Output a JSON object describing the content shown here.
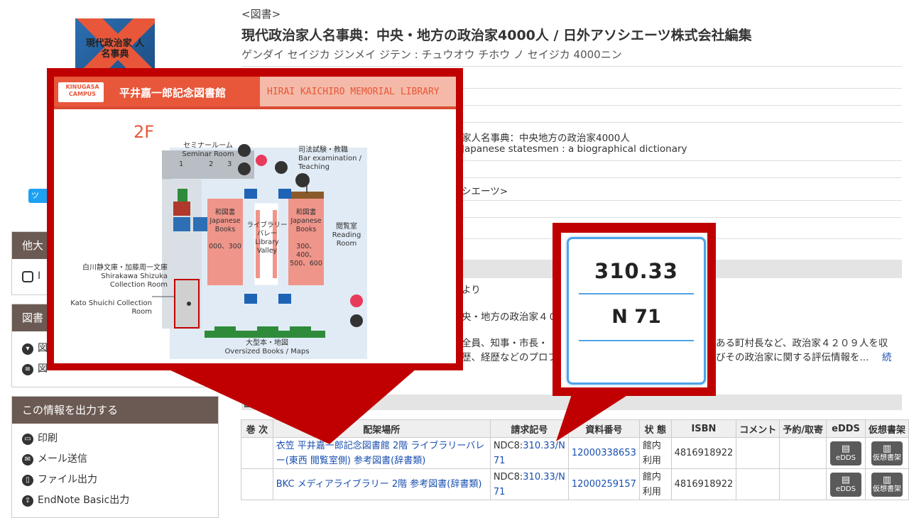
{
  "book": {
    "type": "<図書>",
    "title": "現代政治家人名事典：中央・地方の政治家4000人 / 日外アソシエーツ株式会社編集",
    "reading": "ゲンダイ セイジカ ジンメイ ジテン : チュウオウ チホウ ノ セイジカ 4000ニン",
    "cover_text": "現代政治家 人名事典"
  },
  "partial": {
    "line1": "家人名事典：中央地方の政治家4000人",
    "line2": "Japanese statesmen : a biographical dictionary",
    "line3": "シエーツ>",
    "note1": "より",
    "note2": "央・地方の政治家４０",
    "note3a": "全員、知事・市長・",
    "note3b": "ある町村長など、政治家４２０９人を収",
    "note4a": "歴、経歴などのプロフ",
    "note4b": "びその政治家に関する評伝情報を...",
    "more": "続"
  },
  "sidebar": {
    "twitter": "ツ",
    "panel1": {
      "title": "他大",
      "row1": "I"
    },
    "panel2": {
      "title": "図書",
      "row1": "図",
      "row2": "図"
    },
    "output": {
      "title": "この情報を出力する",
      "items": [
        "印刷",
        "メール送信",
        "ファイル出力",
        "EndNote Basic出力"
      ]
    }
  },
  "holdings": {
    "headers": [
      "巻 次",
      "配架場所",
      "請求記号",
      "資料番号",
      "状 態",
      "ISBN",
      "コメント",
      "予約/取寄",
      "eDDS",
      "仮想書架"
    ],
    "rows": [
      {
        "vol": "",
        "location": "衣笠 平井嘉一郎記念図書館 2階 ライブラリーバレー(東西 閲覧室側) 参考図書(辞書類)",
        "call_prefix": "NDC8:",
        "call_link": "310.33/N 71",
        "item_no": "12000338653",
        "status": "館内利用",
        "isbn": "4816918922",
        "comment": "",
        "reserve": "",
        "edds": "eDDS",
        "shelf": "仮想書架"
      },
      {
        "vol": "",
        "location": "BKC メディアライブラリー 2階 参考図書(辞書類)",
        "call_prefix": "NDC8:",
        "call_link": "310.33/N 71",
        "item_no": "12000259157",
        "status": "館内利用",
        "isbn": "4816918922",
        "comment": "",
        "reserve": "",
        "edds": "eDDS",
        "shelf": "仮想書架"
      }
    ]
  },
  "map": {
    "campus": "KINUGASA CAMPUS",
    "library_ja": "平井嘉一郎記念図書館",
    "library_en": "HIRAI KAICHIRO MEMORIAL LIBRARY",
    "floor": "2F",
    "seminar_ja": "セミナールーム",
    "seminar_en": "Seminar Room",
    "seminar_nums": [
      "1",
      "2",
      "3"
    ],
    "bar_ja": "司法試験・教職",
    "bar_en": "Bar examination / Teaching",
    "wagosho_ja": "和図書",
    "japanese_books": "Japanese Books",
    "left_nums": "000、300",
    "right_nums": "300、400、500、600",
    "valley_ja": "ライブラリーバレー",
    "valley_en": "Library Valley",
    "reading_ja": "閲覧室",
    "reading_en": "Reading Room",
    "shirakawa_ja": "白川静文庫・加藤周一文庫",
    "shirakawa_en": "Shirakawa Shizuka Collection Room",
    "kato_en": "Kato Shuichi Collection Room",
    "oversized_ja": "大型本・地図",
    "oversized_en": "Oversized Books / Maps"
  },
  "spine_label": {
    "line1": "310.33",
    "line2": "N 71"
  },
  "colors": {
    "callout_red": "#c00000",
    "panel_header": "#6b5a53",
    "link_blue": "#1a4fb0",
    "map_orange": "#e8573a"
  }
}
